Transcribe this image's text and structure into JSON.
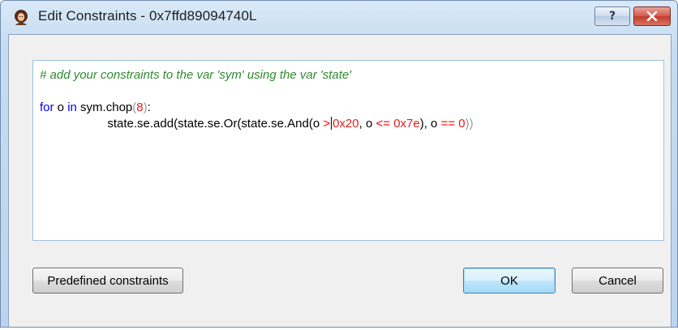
{
  "window": {
    "title": "Edit Constraints - 0x7ffd89094740L",
    "help_label": "?",
    "close_label": "✕"
  },
  "editor": {
    "comment": "# add your constraints to the var 'sym' using the var 'state'",
    "line2": {
      "kw_for": "for",
      "o1": " o ",
      "kw_in": "in",
      "rest": " sym.chop",
      "paren_open": "(",
      "num": "8",
      "paren_close": ")",
      "colon": ":"
    },
    "line3": {
      "indent": "                    ",
      "t1": "state.se.add(state.se.Or(state.se.And(o ",
      "op1": ">",
      "num1": "0x20",
      "t2": ", o ",
      "op2": "<=",
      "sp": " ",
      "num2": "0x7e",
      "t3": "), o ",
      "op3": "==",
      "num3": "0",
      "t4": "))"
    }
  },
  "buttons": {
    "predefined": "Predefined constraints",
    "ok": "OK",
    "cancel": "Cancel"
  },
  "colors": {
    "comment": "#2e8b2e",
    "keyword": "#0000ff",
    "operator": "#ff0000",
    "number": "#e02020"
  },
  "icons": {
    "app_icon": "app-icon",
    "help_icon": "help-icon",
    "close_icon": "close-icon"
  }
}
